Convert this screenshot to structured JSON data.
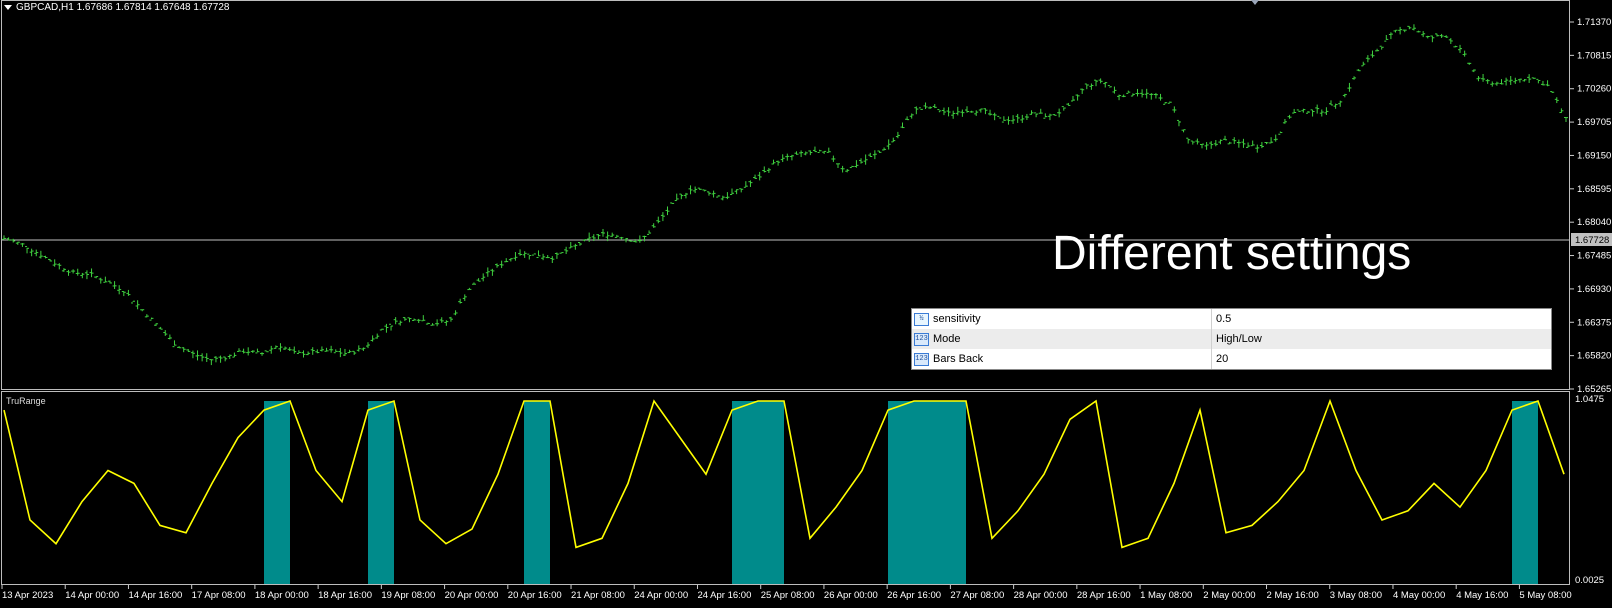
{
  "chart": {
    "symbol_label": "GBPCAD,H1  1.67686 1.67814 1.67648 1.67728",
    "overlay_text": "Different settings",
    "current_price": "1.67728",
    "price_axis_labels": [
      "1.71370",
      "1.70815",
      "1.70260",
      "1.69705",
      "1.69150",
      "1.68595",
      "1.68040",
      "1.67485",
      "1.66930",
      "1.66375",
      "1.65820",
      "1.65265"
    ],
    "indicator_axis_labels": [
      "1.0475",
      "0.0025"
    ],
    "indicator_name": "TruRange",
    "time_axis_labels": [
      "13 Apr 2023",
      "14 Apr 00:00",
      "14 Apr 16:00",
      "17 Apr 08:00",
      "18 Apr 00:00",
      "18 Apr 16:00",
      "19 Apr 08:00",
      "20 Apr 00:00",
      "20 Apr 16:00",
      "21 Apr 08:00",
      "24 Apr 00:00",
      "24 Apr 16:00",
      "25 Apr 08:00",
      "26 Apr 00:00",
      "26 Apr 16:00",
      "27 Apr 08:00",
      "28 Apr 00:00",
      "28 Apr 16:00",
      "1 May 08:00",
      "2 May 00:00",
      "2 May 16:00",
      "3 May 08:00",
      "4 May 00:00",
      "4 May 16:00",
      "5 May 08:00"
    ],
    "colors": {
      "background": "#000000",
      "candles": "#3fd13f",
      "histogram": "#008b8b",
      "indicator_line": "#ffff00",
      "grid_line": "#c0c0c0",
      "axis_text": "#ffffff"
    }
  },
  "settings_table": {
    "rows": [
      {
        "icon": "double-value-icon",
        "name": "sensitivity",
        "value": "0.5"
      },
      {
        "icon": "integer-value-icon",
        "name": "Mode",
        "value": "High/Low"
      },
      {
        "icon": "integer-value-icon",
        "name": "Bars Back",
        "value": "20"
      }
    ]
  },
  "chart_data": {
    "type": "line",
    "series": [
      {
        "values": [
          1.6777,
          1.6768,
          1.6752,
          1.6735,
          1.672,
          1.6718,
          1.6705,
          1.669,
          1.666,
          1.663,
          1.66,
          1.6585,
          1.6575,
          1.658,
          1.659,
          1.6585,
          1.66,
          1.6585,
          1.6588,
          1.659,
          1.6585,
          1.6595,
          1.6625,
          1.664,
          1.6645,
          1.6635,
          1.664,
          1.669,
          1.6715,
          1.6735,
          1.6752,
          1.675,
          1.6745,
          1.676,
          1.6775,
          1.6785,
          1.678,
          1.677,
          1.68,
          1.6835,
          1.686,
          1.6855,
          1.6845,
          1.686,
          1.688,
          1.6905,
          1.6915,
          1.692,
          1.692,
          1.689,
          1.6905,
          1.692,
          1.6945,
          1.699,
          1.6995,
          1.6985,
          1.699,
          1.699,
          1.6975,
          1.6975,
          1.6985,
          1.698,
          1.6995,
          1.703,
          1.704,
          1.7015,
          1.702,
          1.7015,
          1.7,
          1.694,
          1.693,
          1.694,
          1.6935,
          1.693,
          1.694,
          1.6985,
          1.699,
          1.699,
          1.701,
          1.706,
          1.709,
          1.712,
          1.713,
          1.711,
          1.7115,
          1.7085,
          1.704,
          1.7035,
          1.704,
          1.7045,
          1.703,
          1.6975
        ]
      },
      {
        "values": [
          0.95,
          0.35,
          0.22,
          0.45,
          0.62,
          0.55,
          0.32,
          0.28,
          0.55,
          0.8,
          0.95,
          1.0,
          0.62,
          0.45,
          0.95,
          1.0,
          0.35,
          0.22,
          0.3,
          0.6,
          1.0,
          1.0,
          0.2,
          0.25,
          0.55,
          1.0,
          0.8,
          0.6,
          0.95,
          1.0,
          1.0,
          0.25,
          0.42,
          0.62,
          0.95,
          1.0,
          1.0,
          1.0,
          0.25,
          0.4,
          0.6,
          0.9,
          1.0,
          0.2,
          0.25,
          0.55,
          0.95,
          0.28,
          0.32,
          0.45,
          0.62,
          1.0,
          0.62,
          0.35,
          0.4,
          0.55,
          0.42,
          0.62,
          0.95,
          1.0,
          0.6
        ]
      }
    ]
  }
}
